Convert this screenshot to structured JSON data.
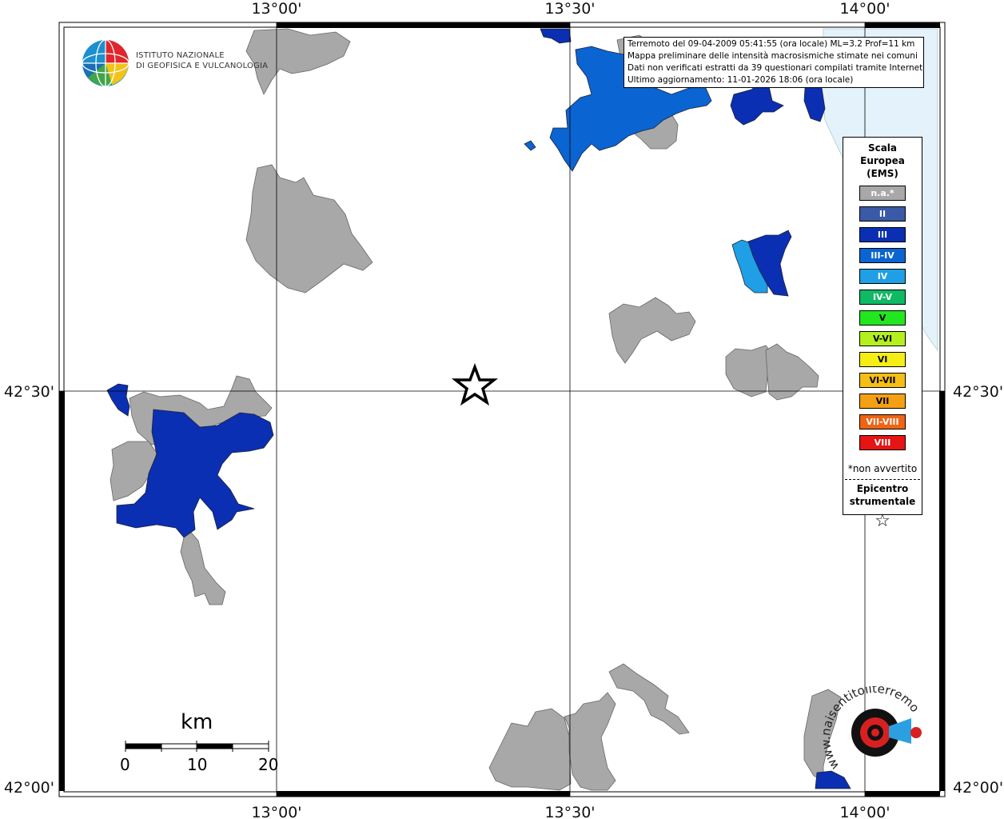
{
  "map": {
    "lon_labels": [
      "13°00'",
      "13°30'",
      "14°00'"
    ],
    "lat_labels": [
      "42°30'",
      "42°00'"
    ]
  },
  "logo": {
    "line1": "ISTITUTO NAZIONALE",
    "line2": "DI GEOFISICA E VULCANOLOGIA"
  },
  "info": {
    "line1": "Terremoto del 09-04-2009 05:41:55 (ora locale) ML=3.2 Prof=11 km",
    "line2": "Mappa preliminare delle intensità macrosismiche stimate nei comuni",
    "line3": "Dati non verificati estratti da 39 questionari compilati tramite Internet.",
    "line4": "Ultimo aggiornamento: 11-01-2026 18:06 (ora locale)"
  },
  "legend": {
    "title_line1": "Scala",
    "title_line2": "Europea",
    "title_line3": "(EMS)",
    "classes": [
      {
        "label": "n.a.*",
        "color": "#a8a8a8"
      },
      {
        "label": "II",
        "color": "#3a5aa8"
      },
      {
        "label": "III",
        "color": "#0a2fb2"
      },
      {
        "label": "III-IV",
        "color": "#0a64d2"
      },
      {
        "label": "IV",
        "color": "#1e9fe6"
      },
      {
        "label": "IV-V",
        "color": "#10b964"
      },
      {
        "label": "V",
        "color": "#22e61e"
      },
      {
        "label": "V-VI",
        "color": "#b4f01e"
      },
      {
        "label": "VI",
        "color": "#f5ee14"
      },
      {
        "label": "VI-VII",
        "color": "#f5be14"
      },
      {
        "label": "VII",
        "color": "#f5a014"
      },
      {
        "label": "VII-VIII",
        "color": "#f06414"
      },
      {
        "label": "VIII",
        "color": "#e61414"
      }
    ],
    "note": "*non avvertito",
    "epicentro_line1": "Epicentro",
    "epicentro_line2": "strumentale",
    "epicentro_symbol": "☆"
  },
  "scale": {
    "title": "km",
    "labels": [
      "0",
      "10",
      "20"
    ]
  },
  "watermark": {
    "text": "www.haisentitoilterremoto.it"
  }
}
